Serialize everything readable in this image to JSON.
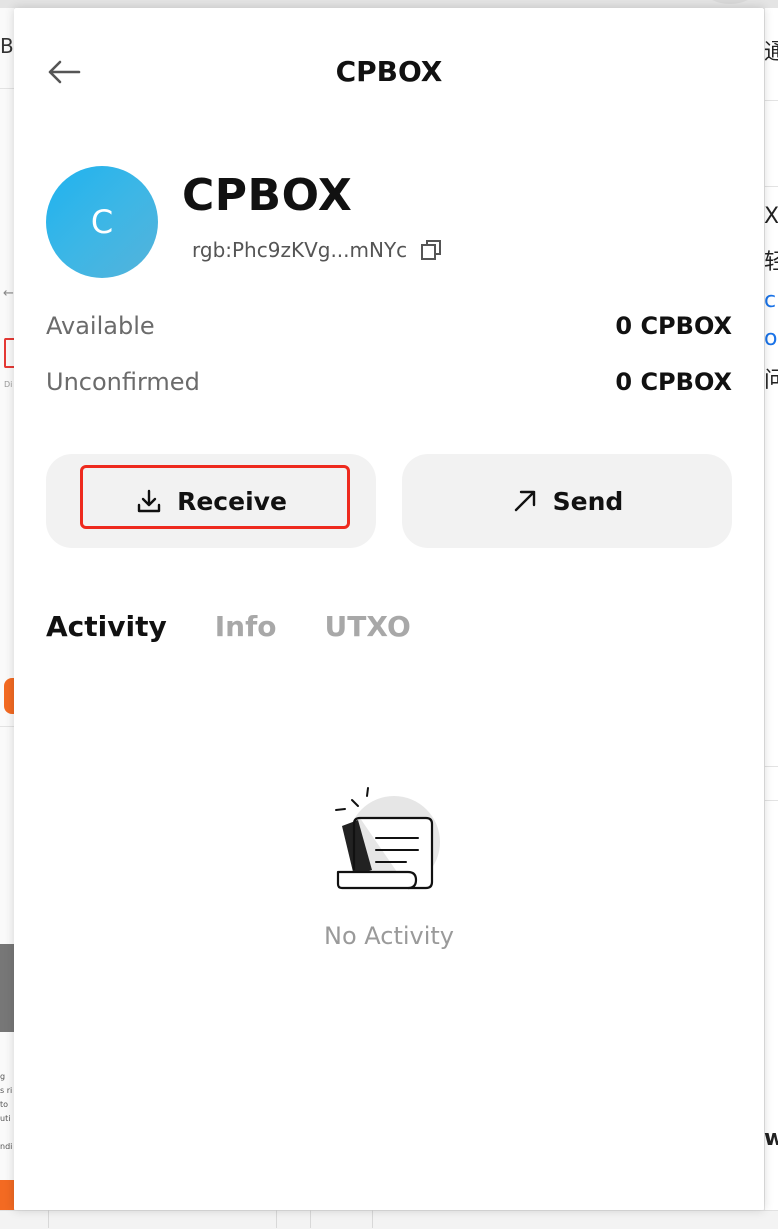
{
  "header": {
    "title": "CPBOX"
  },
  "token": {
    "avatar_letter": "C",
    "name": "CPBOX",
    "id": "rgb:Phc9zKVg...mNYc"
  },
  "balances": {
    "available_label": "Available",
    "available_value": "0 CPBOX",
    "unconfirmed_label": "Unconfirmed",
    "unconfirmed_value": "0 CPBOX"
  },
  "actions": {
    "receive_label": "Receive",
    "send_label": "Send"
  },
  "tabs": [
    {
      "label": "Activity",
      "active": true
    },
    {
      "label": "Info",
      "active": false
    },
    {
      "label": "UTXO",
      "active": false
    }
  ],
  "empty_state": {
    "text": "No Activity"
  },
  "background": {
    "left_char": "B",
    "right_chars": [
      "通",
      "X",
      "轻",
      "c",
      "o",
      "问",
      "w"
    ]
  },
  "colors": {
    "avatar_gradient_start": "#1fb3ef",
    "avatar_gradient_end": "#55b3da",
    "highlight": "#ee2a1e",
    "button_bg": "#f2f2f2"
  },
  "icons": {
    "back": "arrow-left-icon",
    "copy": "copy-icon",
    "receive": "download-icon",
    "send": "arrow-up-right-icon",
    "empty": "receipt-icon"
  }
}
